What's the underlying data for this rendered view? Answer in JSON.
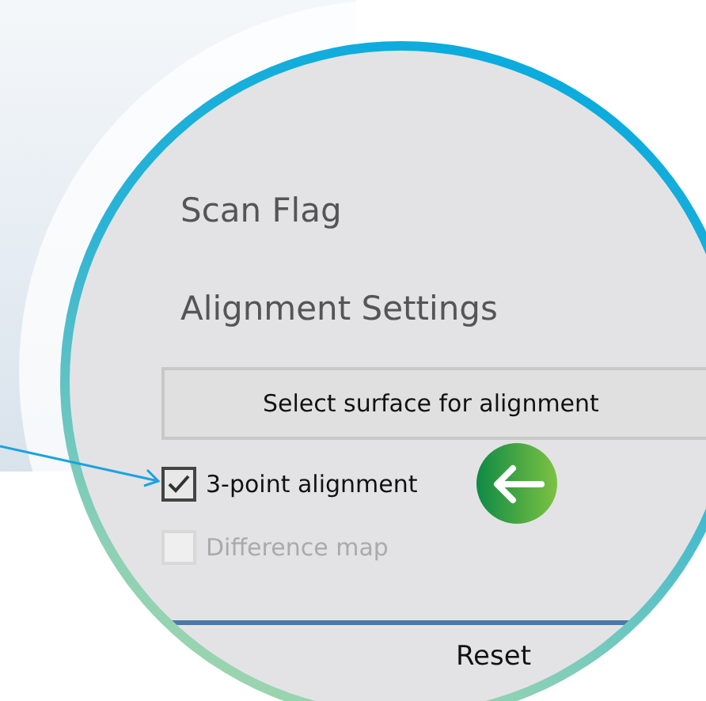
{
  "headings": [
    "Scan Flag",
    "Alignment Settings"
  ],
  "select_button": {
    "label": "Select surface for alignment"
  },
  "options": [
    {
      "label": "3-point alignment",
      "checked": true,
      "disabled": false
    },
    {
      "label": "Difference map",
      "checked": false,
      "disabled": true
    }
  ],
  "reset_button": {
    "label": "Reset"
  }
}
